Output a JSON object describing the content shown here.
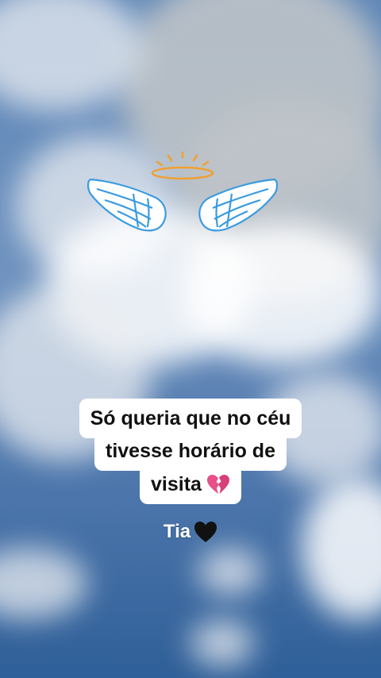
{
  "caption": {
    "line1": "Só queria que no céu",
    "line2": "tivesse horário de",
    "line3": "visita"
  },
  "signature": {
    "text": "Tia"
  },
  "icons": {
    "halo": "halo-icon",
    "left_wing": "wing-left-icon",
    "right_wing": "wing-right-icon",
    "broken_heart": "broken-heart-emoji",
    "black_heart": "black-heart-emoji"
  },
  "colors": {
    "sky": "#5f87b8",
    "halo": "#f0a030",
    "wing_outline": "#3a9be0",
    "broken_heart": "#e8508a",
    "black_heart": "#111111"
  }
}
